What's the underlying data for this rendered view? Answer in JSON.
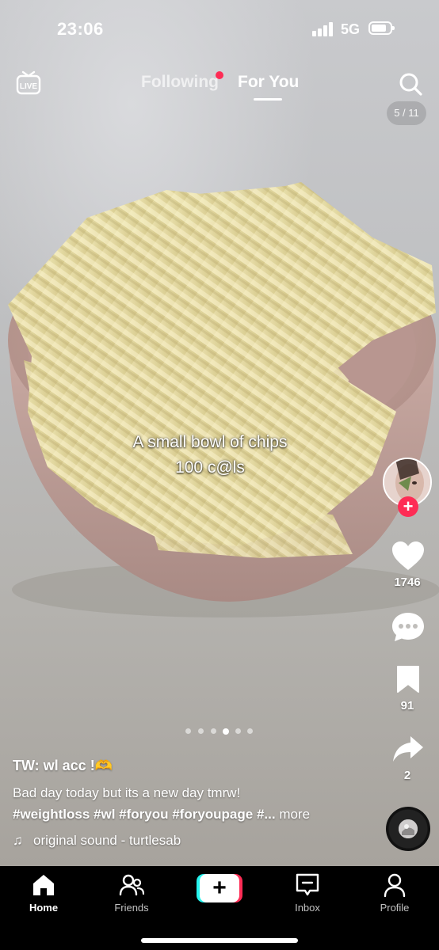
{
  "status_bar": {
    "time": "23:06",
    "network": "5G"
  },
  "top_nav": {
    "live_label": "LIVE",
    "following_label": "Following",
    "for_you_label": "For You",
    "page_counter": "5 / 11"
  },
  "video": {
    "overlay_text_line1": "A small bowl of chips",
    "overlay_text_line2": "100 c@ls",
    "carousel_total": 6,
    "carousel_active": 4
  },
  "actions": {
    "likes": "1746",
    "bookmarks": "91",
    "shares": "2"
  },
  "caption": {
    "username": "TW: wl acc !🫶",
    "description": "Bad day today but its a new day tmrw!",
    "hashtags": "#weightloss #wl #foryou #foryoupage #...",
    "more_label": "more",
    "sound": "original sound - turtlesab"
  },
  "bottom_nav": {
    "home": "Home",
    "friends": "Friends",
    "create": "+",
    "inbox": "Inbox",
    "profile": "Profile"
  },
  "colors": {
    "accent_red": "#fe2c55",
    "accent_cyan": "#25f4ee",
    "nav_background": "#000000"
  }
}
